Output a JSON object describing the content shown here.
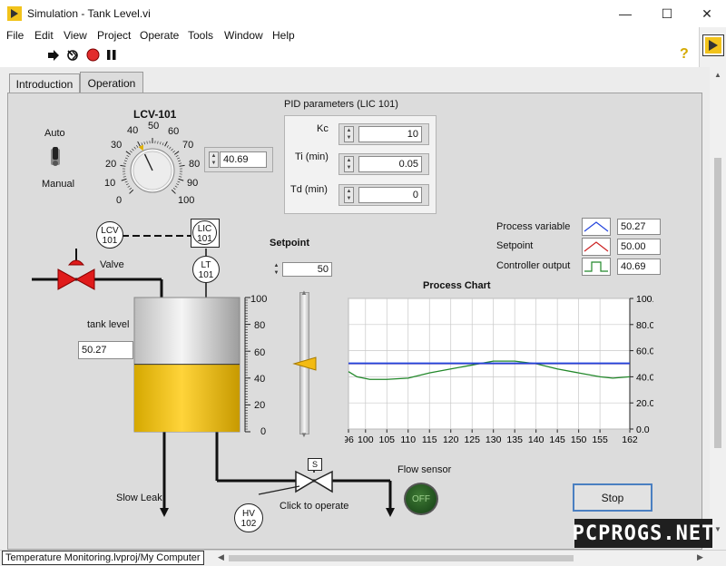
{
  "window": {
    "title": "Simulation - Tank Level.vi",
    "minimize": "—",
    "maximize": "☐",
    "close": "✕"
  },
  "menu": [
    "File",
    "Edit",
    "View",
    "Project",
    "Operate",
    "Tools",
    "Window",
    "Help"
  ],
  "tabs": [
    {
      "label": "Introduction"
    },
    {
      "label": "Operation"
    }
  ],
  "lcv": {
    "title": "LCV-101",
    "scale": [
      "0",
      "10",
      "20",
      "30",
      "40",
      "50",
      "60",
      "70",
      "80",
      "90",
      "100"
    ],
    "value": "40.69",
    "auto_label": "Auto",
    "manual_label": "Manual"
  },
  "pid": {
    "title": "PID parameters (LIC 101)",
    "kc_label": "Kc",
    "kc_value": "10",
    "ti_label": "Ti (min)",
    "ti_value": "0.05",
    "td_label": "Td (min)",
    "td_value": "0"
  },
  "diagram": {
    "lcv_tag": [
      "LCV",
      "101"
    ],
    "lic_tag": [
      "LIC",
      "101"
    ],
    "lt_tag": [
      "LT",
      "101"
    ],
    "hv_tag": [
      "HV",
      "102"
    ],
    "valve_label": "Valve",
    "tank_level_label": "tank level",
    "tank_level_value": "50.27",
    "tank_fill": 0.5027,
    "tank_scale": [
      "100",
      "80",
      "60",
      "40",
      "20",
      "0"
    ],
    "slow_leak_label": "Slow Leak",
    "click_to_operate": "Click to operate",
    "solenoid_label": "S",
    "flow_sensor_label": "Flow sensor",
    "flow_sensor_state": "OFF"
  },
  "setpoint": {
    "label": "Setpoint",
    "value": "50",
    "slider_value": 50
  },
  "legend": [
    {
      "name": "Process variable",
      "value": "50.27",
      "color": "#2244dd"
    },
    {
      "name": "Setpoint",
      "value": "50.00",
      "color": "#cc2222"
    },
    {
      "name": "Controller output",
      "value": "40.69",
      "color": "#22882a"
    }
  ],
  "stop_label": "Stop",
  "status_path": "Temperature Monitoring.lvproj/My Computer",
  "watermark": "PCPROGS.NET",
  "chart_data": {
    "type": "line",
    "title": "Process Chart",
    "xlim": [
      96,
      162
    ],
    "ylim": [
      0,
      100
    ],
    "x_ticks": [
      96,
      100,
      105,
      110,
      115,
      120,
      125,
      130,
      135,
      140,
      145,
      150,
      155,
      162
    ],
    "y_ticks": [
      "0.0",
      "20.0",
      "40.0",
      "60.0",
      "80.0",
      "100.0"
    ],
    "grid": true,
    "series": [
      {
        "name": "Process variable",
        "color": "#2244dd",
        "x": [
          96,
          105,
          115,
          125,
          135,
          145,
          155,
          162
        ],
        "y": [
          50.3,
          50.3,
          50.3,
          50.3,
          50.3,
          50.3,
          50.3,
          50.3
        ]
      },
      {
        "name": "Setpoint",
        "color": "#cc2222",
        "x": [
          96,
          105,
          115,
          125,
          135,
          145,
          155,
          162
        ],
        "y": [
          50,
          50,
          50,
          50,
          50,
          50,
          50,
          50
        ]
      },
      {
        "name": "Controller output",
        "color": "#22882a",
        "x": [
          96,
          98,
          101,
          105,
          110,
          115,
          120,
          125,
          130,
          135,
          140,
          145,
          150,
          155,
          158,
          162
        ],
        "y": [
          44,
          40,
          38,
          38,
          39,
          43,
          46,
          49,
          52,
          52,
          50,
          46,
          43,
          40,
          39,
          40
        ]
      }
    ]
  }
}
